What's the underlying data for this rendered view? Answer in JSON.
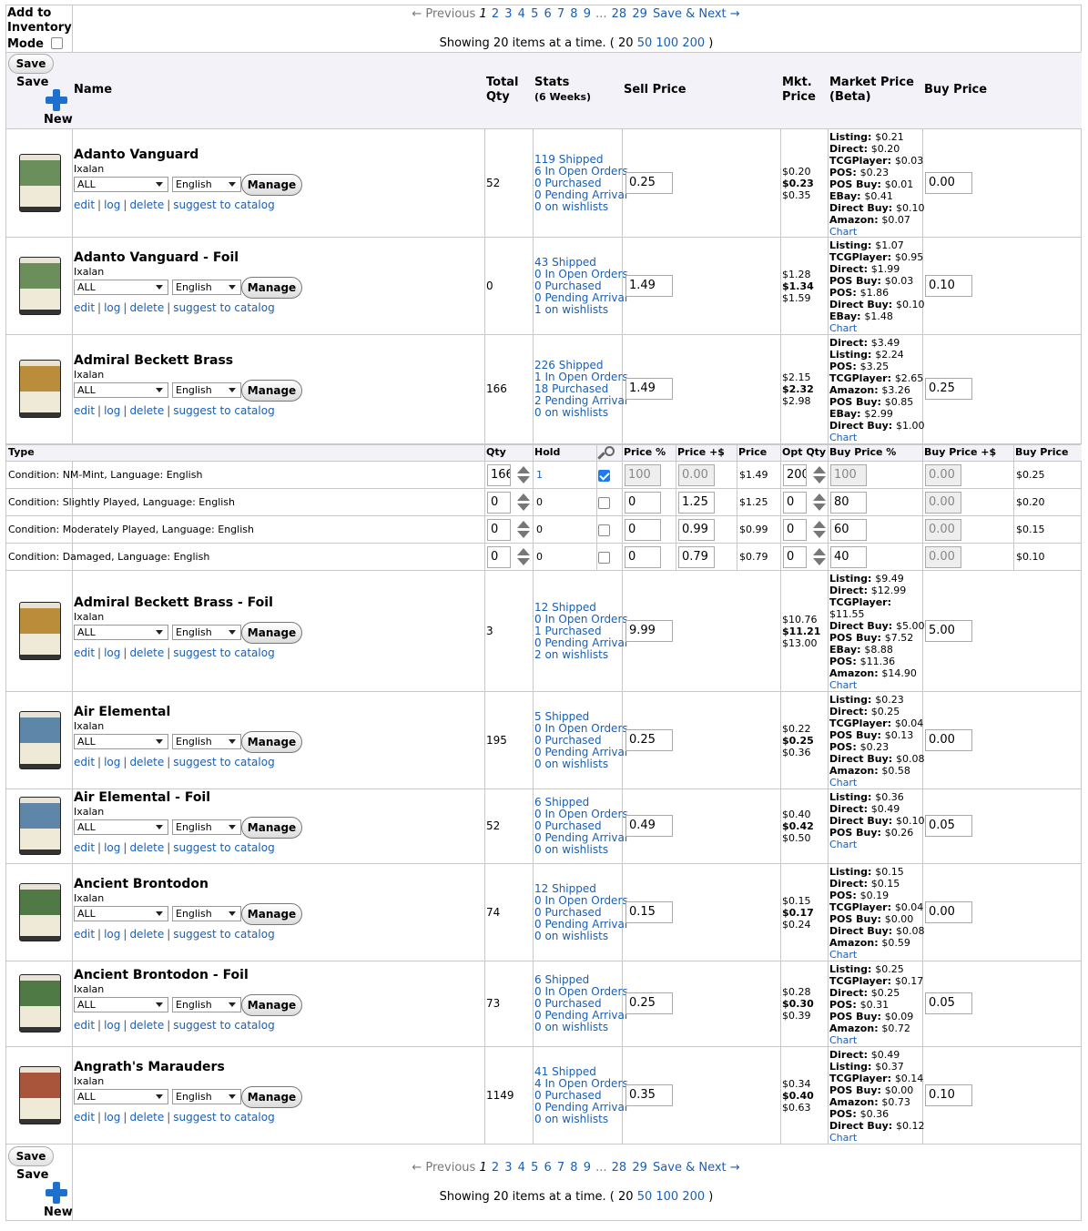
{
  "header_controls": {
    "inventory_mode_label": "Add to Inventory Mode",
    "save_button": "Save",
    "save_label": "Save",
    "new_label": "New"
  },
  "pagination": {
    "previous": "← Previous",
    "current": "1",
    "pages": [
      "2",
      "3",
      "4",
      "5",
      "6",
      "7",
      "8",
      "9"
    ],
    "ellipsis": "...",
    "last_pages": [
      "28",
      "29"
    ],
    "save_next": "Save & Next →",
    "showing_prefix": "Showing 20 items at a time. (",
    "per_page_current": "20",
    "per_page_options": [
      "50",
      "100",
      "200"
    ],
    "showing_suffix": ")"
  },
  "columns": {
    "name": "Name",
    "total_qty": "Total Qty",
    "stats": "Stats",
    "stats_sub": "(6 Weeks)",
    "sell_price": "Sell Price",
    "mkt_price": "Mkt. Price",
    "market_price_beta": "Market Price (Beta)",
    "buy_price": "Buy Price"
  },
  "product_links": {
    "edit": "edit",
    "log": "log",
    "delete": "delete",
    "suggest": "suggest to catalog",
    "manage": "Manage",
    "chart": "Chart"
  },
  "products": [
    {
      "name": "Adanto Vanguard",
      "set": "Ixalan",
      "filter": "ALL",
      "language": "English",
      "total_qty": "52",
      "stats": [
        "119 Shipped",
        "6 In Open Orders",
        "0 Purchased",
        "0 Pending Arrival",
        "0 on wishlists"
      ],
      "sell_price": "0.25",
      "mkt_low": "$0.20",
      "mkt_mid": "$0.23",
      "mkt_high": "$0.35",
      "market": [
        [
          "Listing:",
          "$0.21"
        ],
        [
          "Direct:",
          "$0.20"
        ],
        [
          "TCGPlayer:",
          "$0.03"
        ],
        [
          "POS:",
          "$0.23"
        ],
        [
          "POS Buy:",
          "$0.01"
        ],
        [
          "EBay:",
          "$0.41"
        ],
        [
          "Direct Buy:",
          "$0.10"
        ],
        [
          "Amazon:",
          "$0.07"
        ]
      ],
      "buy_price": "0.00",
      "art": "green"
    },
    {
      "name": "Adanto Vanguard - Foil",
      "set": "Ixalan",
      "filter": "ALL",
      "language": "English",
      "total_qty": "0",
      "stats": [
        "43 Shipped",
        "0 In Open Orders",
        "0 Purchased",
        "0 Pending Arrival",
        "1 on wishlists"
      ],
      "sell_price": "1.49",
      "mkt_low": "$1.28",
      "mkt_mid": "$1.34",
      "mkt_high": "$1.59",
      "market": [
        [
          "Listing:",
          "$1.07"
        ],
        [
          "TCGPlayer:",
          "$0.95"
        ],
        [
          "Direct:",
          "$1.99"
        ],
        [
          "POS Buy:",
          "$0.03"
        ],
        [
          "POS:",
          "$1.86"
        ],
        [
          "Direct Buy:",
          "$0.10"
        ],
        [
          "EBay:",
          "$1.48"
        ]
      ],
      "buy_price": "0.10",
      "art": "green"
    },
    {
      "name": "Admiral Beckett Brass",
      "set": "Ixalan",
      "filter": "ALL",
      "language": "English",
      "total_qty": "166",
      "stats": [
        "226 Shipped",
        "1 In Open Orders",
        "18 Purchased",
        "2 Pending Arrival",
        "0 on wishlists"
      ],
      "sell_price": "1.49",
      "mkt_low": "$2.15",
      "mkt_mid": "$2.32",
      "mkt_high": "$2.98",
      "market": [
        [
          "Direct:",
          "$3.49"
        ],
        [
          "Listing:",
          "$2.24"
        ],
        [
          "POS:",
          "$3.25"
        ],
        [
          "TCGPlayer:",
          "$2.65"
        ],
        [
          "Amazon:",
          "$3.26"
        ],
        [
          "POS Buy:",
          "$0.85"
        ],
        [
          "EBay:",
          "$2.99"
        ],
        [
          "Direct Buy:",
          "$1.00"
        ]
      ],
      "buy_price": "0.25",
      "art": "gold"
    },
    {
      "name": "Admiral Beckett Brass - Foil",
      "set": "Ixalan",
      "filter": "ALL",
      "language": "English",
      "total_qty": "3",
      "stats": [
        "12 Shipped",
        "0 In Open Orders",
        "1 Purchased",
        "0 Pending Arrival",
        "2 on wishlists"
      ],
      "sell_price": "9.99",
      "mkt_low": "$10.76",
      "mkt_mid": "$11.21",
      "mkt_high": "$13.00",
      "market": [
        [
          "Listing:",
          "$9.49"
        ],
        [
          "Direct:",
          "$12.99"
        ],
        [
          "TCGPlayer:",
          ""
        ],
        [
          "",
          "$11.55"
        ],
        [
          "Direct Buy:",
          "$5.00"
        ],
        [
          "POS Buy:",
          "$7.52"
        ],
        [
          "EBay:",
          "$8.88"
        ],
        [
          "POS:",
          "$11.36"
        ],
        [
          "Amazon:",
          "$14.90"
        ]
      ],
      "buy_price": "5.00",
      "art": "gold"
    },
    {
      "name": "Air Elemental",
      "set": "Ixalan",
      "filter": "ALL",
      "language": "English",
      "total_qty": "195",
      "stats": [
        "5 Shipped",
        "0 In Open Orders",
        "0 Purchased",
        "0 Pending Arrival",
        "0 on wishlists"
      ],
      "sell_price": "0.25",
      "mkt_low": "$0.22",
      "mkt_mid": "$0.25",
      "mkt_high": "$0.36",
      "market": [
        [
          "Listing:",
          "$0.23"
        ],
        [
          "Direct:",
          "$0.25"
        ],
        [
          "TCGPlayer:",
          "$0.04"
        ],
        [
          "POS Buy:",
          "$0.13"
        ],
        [
          "POS:",
          "$0.23"
        ],
        [
          "Direct Buy:",
          "$0.08"
        ],
        [
          "Amazon:",
          "$0.58"
        ]
      ],
      "buy_price": "0.00",
      "art": "blue"
    },
    {
      "name": "Air Elemental - Foil",
      "set": "Ixalan",
      "filter": "ALL",
      "language": "English",
      "total_qty": "52",
      "stats": [
        "6 Shipped",
        "0 In Open Orders",
        "0 Purchased",
        "0 Pending Arrival",
        "0 on wishlists"
      ],
      "sell_price": "0.49",
      "mkt_low": "$0.40",
      "mkt_mid": "$0.42",
      "mkt_high": "$0.50",
      "market": [
        [
          "Listing:",
          "$0.36"
        ],
        [
          "Direct:",
          "$0.49"
        ],
        [
          "Direct Buy:",
          "$0.10"
        ],
        [
          "POS Buy:",
          "$0.26"
        ]
      ],
      "buy_price": "0.05",
      "art": "blue"
    },
    {
      "name": "Ancient Brontodon",
      "set": "Ixalan",
      "filter": "ALL",
      "language": "English",
      "total_qty": "74",
      "stats": [
        "12 Shipped",
        "0 In Open Orders",
        "0 Purchased",
        "0 Pending Arrival",
        "0 on wishlists"
      ],
      "sell_price": "0.15",
      "mkt_low": "$0.15",
      "mkt_mid": "$0.17",
      "mkt_high": "$0.24",
      "market": [
        [
          "Listing:",
          "$0.15"
        ],
        [
          "Direct:",
          "$0.15"
        ],
        [
          "POS:",
          "$0.19"
        ],
        [
          "TCGPlayer:",
          "$0.04"
        ],
        [
          "POS Buy:",
          "$0.00"
        ],
        [
          "Direct Buy:",
          "$0.08"
        ],
        [
          "Amazon:",
          "$0.59"
        ]
      ],
      "buy_price": "0.00",
      "art": "dgreen"
    },
    {
      "name": "Ancient Brontodon - Foil",
      "set": "Ixalan",
      "filter": "ALL",
      "language": "English",
      "total_qty": "73",
      "stats": [
        "6 Shipped",
        "0 In Open Orders",
        "0 Purchased",
        "0 Pending Arrival",
        "0 on wishlists"
      ],
      "sell_price": "0.25",
      "mkt_low": "$0.28",
      "mkt_mid": "$0.30",
      "mkt_high": "$0.39",
      "market": [
        [
          "Listing:",
          "$0.25"
        ],
        [
          "TCGPlayer:",
          "$0.17"
        ],
        [
          "Direct:",
          "$0.25"
        ],
        [
          "POS:",
          "$0.31"
        ],
        [
          "POS Buy:",
          "$0.09"
        ],
        [
          "Amazon:",
          "$0.72"
        ]
      ],
      "buy_price": "0.05",
      "art": "dgreen"
    },
    {
      "name": "Angrath's Marauders",
      "set": "Ixalan",
      "filter": "ALL",
      "language": "English",
      "total_qty": "1149",
      "stats": [
        "41 Shipped",
        "4 In Open Orders",
        "0 Purchased",
        "0 Pending Arrival",
        "0 on wishlists"
      ],
      "sell_price": "0.35",
      "mkt_low": "$0.34",
      "mkt_mid": "$0.40",
      "mkt_high": "$0.63",
      "market": [
        [
          "Direct:",
          "$0.49"
        ],
        [
          "Listing:",
          "$0.37"
        ],
        [
          "TCGPlayer:",
          "$0.14"
        ],
        [
          "POS Buy:",
          "$0.00"
        ],
        [
          "Amazon:",
          "$0.73"
        ],
        [
          "POS:",
          "$0.36"
        ],
        [
          "Direct Buy:",
          "$0.12"
        ]
      ],
      "buy_price": "0.10",
      "art": "red"
    }
  ],
  "conditions_table": {
    "headers": {
      "type": "Type",
      "qty": "Qty",
      "hold": "Hold",
      "price_pct": "Price %",
      "price_plus": "Price +$",
      "price": "Price",
      "opt_qty": "Opt Qty",
      "buy_pct": "Buy Price %",
      "buy_plus": "Buy Price +$",
      "buy_price": "Buy Price"
    },
    "rows": [
      {
        "type": "Condition: NM-Mint, Language: English",
        "qty": "166",
        "hold": "1",
        "checked": true,
        "price_pct": "100",
        "price_plus": "0.00",
        "price": "$1.49",
        "opt_qty": "200",
        "buy_pct": "100",
        "buy_plus": "0.00",
        "buy_price": "$0.25"
      },
      {
        "type": "Condition: Slightly Played, Language: English",
        "qty": "0",
        "hold": "0",
        "checked": false,
        "price_pct": "0",
        "price_plus": "1.25",
        "price": "$1.25",
        "opt_qty": "0",
        "buy_pct": "80",
        "buy_plus": "0.00",
        "buy_price": "$0.20"
      },
      {
        "type": "Condition: Moderately Played, Language: English",
        "qty": "0",
        "hold": "0",
        "checked": false,
        "price_pct": "0",
        "price_plus": "0.99",
        "price": "$0.99",
        "opt_qty": "0",
        "buy_pct": "60",
        "buy_plus": "0.00",
        "buy_price": "$0.15"
      },
      {
        "type": "Condition: Damaged, Language: English",
        "qty": "0",
        "hold": "0",
        "checked": false,
        "price_pct": "0",
        "price_plus": "0.79",
        "price": "$0.79",
        "opt_qty": "0",
        "buy_pct": "40",
        "buy_plus": "0.00",
        "buy_price": "$0.10"
      }
    ]
  },
  "art_colors": {
    "green": "#6a8f5a",
    "gold": "#b98d3a",
    "blue": "#5d86a8",
    "dgreen": "#4f7a46",
    "red": "#a8553c"
  }
}
